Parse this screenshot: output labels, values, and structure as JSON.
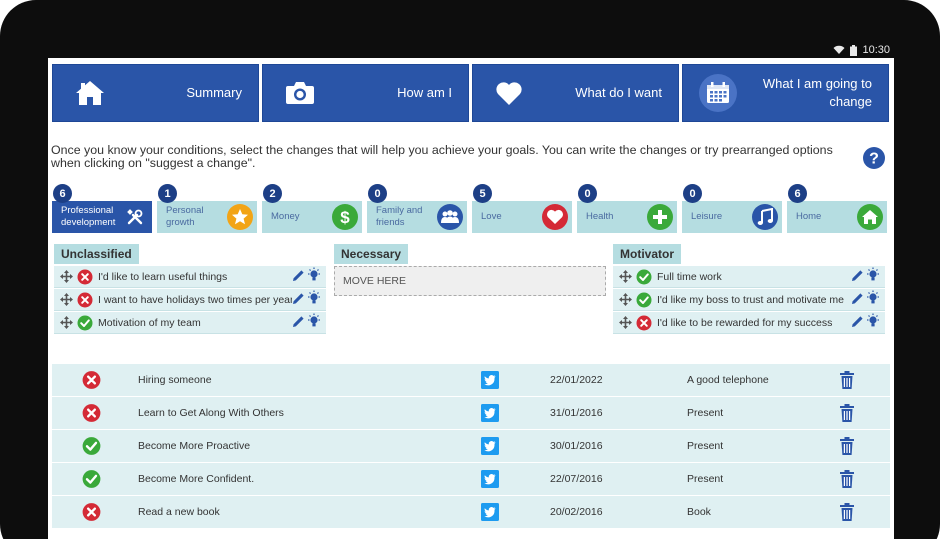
{
  "status_bar": {
    "time": "10:30"
  },
  "nav": [
    {
      "label": "Summary",
      "icon": "home-icon"
    },
    {
      "label": "How am I",
      "icon": "camera-icon"
    },
    {
      "label": "What do I want",
      "icon": "heart-icon"
    },
    {
      "label": "What I am going to change",
      "icon": "calendar-icon"
    }
  ],
  "intro": "Once you know your conditions, select the changes that will help you achieve your goals. You can write the changes or try prearranged options when clicking on \"suggest a change\".",
  "categories": [
    {
      "count": "6",
      "label": "Professional development",
      "icon": "tools-icon",
      "icon_color": "#2a55a8"
    },
    {
      "count": "1",
      "label": "Personal growth",
      "icon": "star-icon",
      "icon_color": "#f2a416"
    },
    {
      "count": "2",
      "label": "Money",
      "icon": "dollar-icon",
      "icon_color": "#3aa93a"
    },
    {
      "count": "0",
      "label": "Family and friends",
      "icon": "people-icon",
      "icon_color": "#2a55a8"
    },
    {
      "count": "5",
      "label": "Love",
      "icon": "heart-icon",
      "icon_color": "#d42a36"
    },
    {
      "count": "0",
      "label": "Health",
      "icon": "plus-icon",
      "icon_color": "#3aa93a"
    },
    {
      "count": "0",
      "label": "Leisure",
      "icon": "music-icon",
      "icon_color": "#2a55a8"
    },
    {
      "count": "6",
      "label": "Home",
      "icon": "home-icon",
      "icon_color": "#3aa93a"
    }
  ],
  "columns": {
    "unclassified": {
      "title": "Unclassified",
      "items": [
        {
          "text": "I'd like to learn useful things",
          "status": "negative"
        },
        {
          "text": "I want to have holidays two times per year",
          "status": "negative"
        },
        {
          "text": "Motivation of my team",
          "status": "positive"
        }
      ]
    },
    "necessary": {
      "title": "Necessary",
      "drop_text": "MOVE HERE"
    },
    "motivator": {
      "title": "Motivator",
      "items": [
        {
          "text": "Full time work",
          "status": "positive"
        },
        {
          "text": "I'd like my boss to trust and motivate me",
          "status": "positive"
        },
        {
          "text": "I'd like to be rewarded for my success",
          "status": "negative"
        }
      ]
    }
  },
  "changes": [
    {
      "status": "negative",
      "name": "Hiring someone",
      "date": "22/01/2022",
      "note": "A good telephone"
    },
    {
      "status": "negative",
      "name": "Learn to Get Along With Others",
      "date": "31/01/2016",
      "note": "Present"
    },
    {
      "status": "positive",
      "name": "Become More Proactive",
      "date": "30/01/2016",
      "note": "Present"
    },
    {
      "status": "positive",
      "name": "Become More Confident.",
      "date": "22/07/2016",
      "note": "Present"
    },
    {
      "status": "negative",
      "name": "Read a new book",
      "date": "20/02/2016",
      "note": "Book"
    }
  ],
  "colors": {
    "primary": "#2a55a8",
    "light_teal": "#b5dde1",
    "row_bg": "#dff0f2",
    "positive": "#3aa93a",
    "negative": "#d42a36"
  }
}
